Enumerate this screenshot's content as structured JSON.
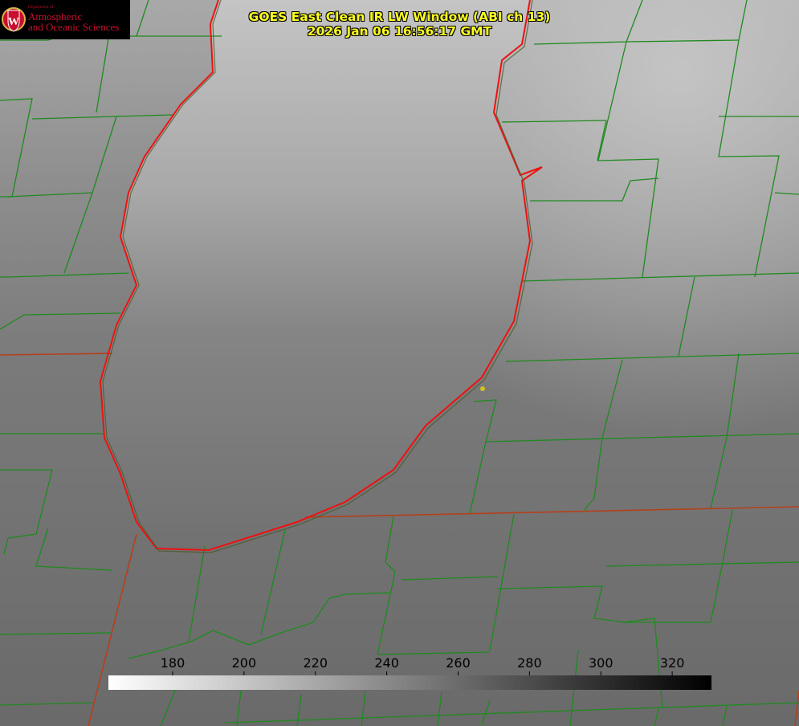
{
  "logo": {
    "department": "Department of",
    "line1": "Atmospheric",
    "line2": "and Oceanic Sciences",
    "seal_letter": "W"
  },
  "title": {
    "line1": "GOES East Clean IR LW Window (ABI ch 13)",
    "line2": "2026 Jan 06 16:56:17 GMT"
  },
  "colorbar": {
    "ticks": [
      "180",
      "200",
      "220",
      "240",
      "260",
      "280",
      "300",
      "320"
    ],
    "min": 162,
    "max": 331,
    "gradient": "white-to-black"
  },
  "colors": {
    "county_lines": "#1f8a1f",
    "state_lines": "#b5401c",
    "lake_shore": "#ee1111",
    "title_text": "#ffff22",
    "logo_text": "#c8102e"
  }
}
